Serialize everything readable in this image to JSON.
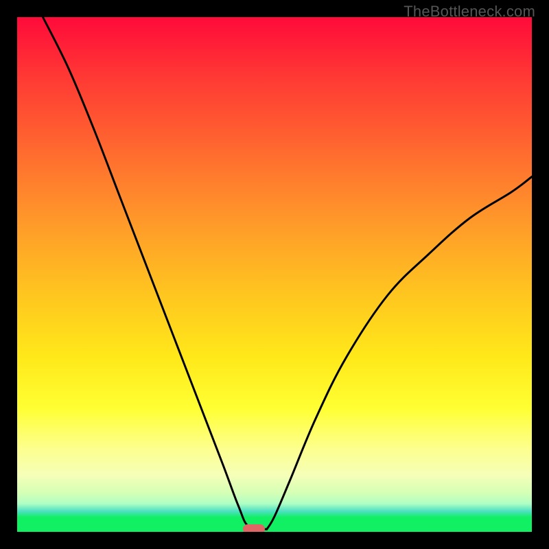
{
  "watermark": "TheBottleneck.com",
  "colors": {
    "frame": "#000000",
    "curve": "#000000",
    "marker": "#e06666",
    "gradient_stops": [
      "#ff0a3a",
      "#ff3a34",
      "#ff6a2f",
      "#ff9a2a",
      "#ffc61f",
      "#ffe81a",
      "#ffff33",
      "#fdff8f",
      "#f5ffb8",
      "#d4ffb5",
      "#b0ffc4",
      "#4de0c2",
      "#11ef63"
    ]
  },
  "chart_data": {
    "type": "line",
    "title": "",
    "xlabel": "",
    "ylabel": "",
    "xlim": [
      0,
      100
    ],
    "ylim": [
      0,
      100
    ],
    "grid": false,
    "marker": {
      "x": 46,
      "y": 0.5
    },
    "series": [
      {
        "name": "bottleneck-curve",
        "segments": [
          {
            "name": "left",
            "x": [
              5,
              10,
              15,
              20,
              25,
              30,
              35,
              40,
              43,
              45,
              48.5
            ],
            "y": [
              100,
              90,
              78,
              65,
              52,
              39,
              26,
              13,
              5,
              1,
              0.5
            ]
          },
          {
            "name": "right",
            "x": [
              48.5,
              50,
              53,
              58,
              64,
              72,
              80,
              88,
              96,
              100
            ],
            "y": [
              0.5,
              3,
              10,
              22,
              34,
              46,
              54,
              61,
              66,
              69
            ]
          }
        ]
      }
    ]
  }
}
